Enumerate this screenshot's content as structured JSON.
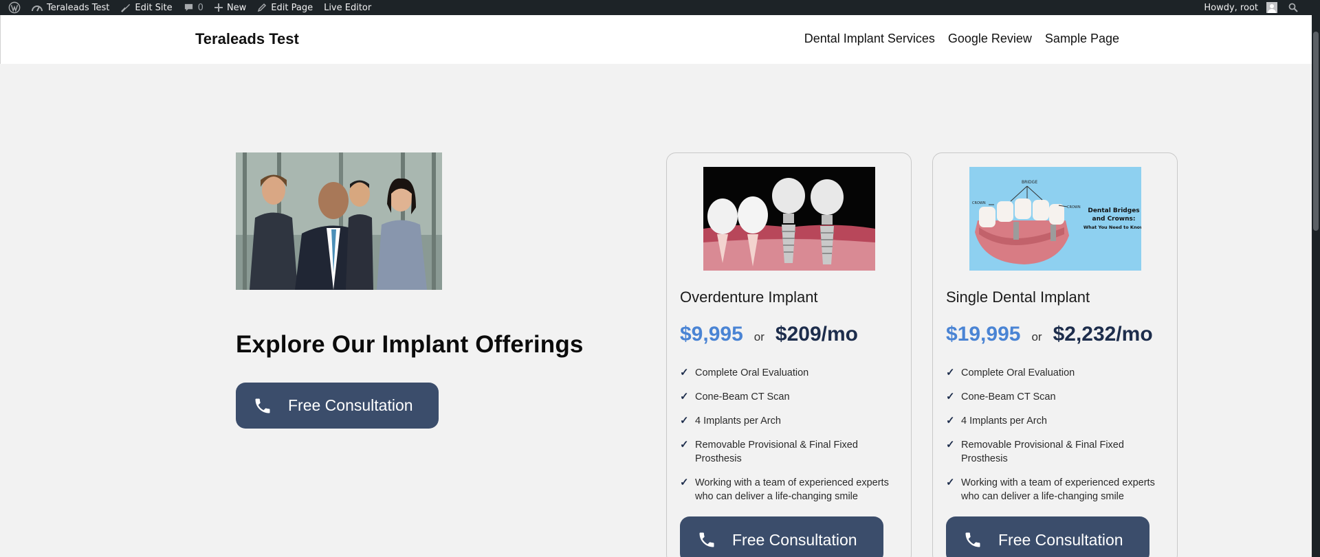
{
  "adminbar": {
    "site_name": "Teraleads Test",
    "edit_site": "Edit Site",
    "comments_count": "0",
    "new_label": "New",
    "edit_page": "Edit Page",
    "live_editor": "Live Editor",
    "howdy": "Howdy, root"
  },
  "header": {
    "site_title": "Teraleads Test",
    "nav": [
      "Dental Implant Services",
      "Google Review",
      "Sample Page"
    ]
  },
  "hero": {
    "heading": "Explore Our Implant Offerings",
    "cta_label": "Free Consultation"
  },
  "cards": [
    {
      "title": "Overdenture Implant",
      "price": "$9,995",
      "or": "or",
      "monthly": "$209/mo",
      "features": [
        "Complete Oral Evaluation",
        "Cone-Beam CT Scan",
        "4 Implants per Arch",
        "Removable Provisional & Final Fixed Prosthesis",
        "Working with a team of experienced experts who can deliver a life-changing smile"
      ],
      "cta_label": "Free Consultation"
    },
    {
      "title": "Single Dental Implant",
      "price": "$19,995",
      "or": "or",
      "monthly": "$2,232/mo",
      "features": [
        "Complete Oral Evaluation",
        "Cone-Beam CT Scan",
        "4 Implants per Arch",
        "Removable Provisional & Final Fixed Prosthesis",
        "Working with a team of experienced experts who can deliver a life-changing smile"
      ],
      "cta_label": "Free Consultation",
      "image_text": {
        "bridge": "BRIDGE",
        "crown_left": "CROWN",
        "crown_right": "CROWN",
        "headline_1": "Dental Bridges",
        "headline_2": "and Crowns:",
        "headline_3": "What You Need to Know"
      }
    }
  ],
  "colors": {
    "adminbar_bg": "#1d2327",
    "page_bg": "#f2f2f2",
    "button_bg": "#3b4d6b",
    "price_blue": "#4a84d4",
    "price_navy": "#1d2d4c"
  }
}
